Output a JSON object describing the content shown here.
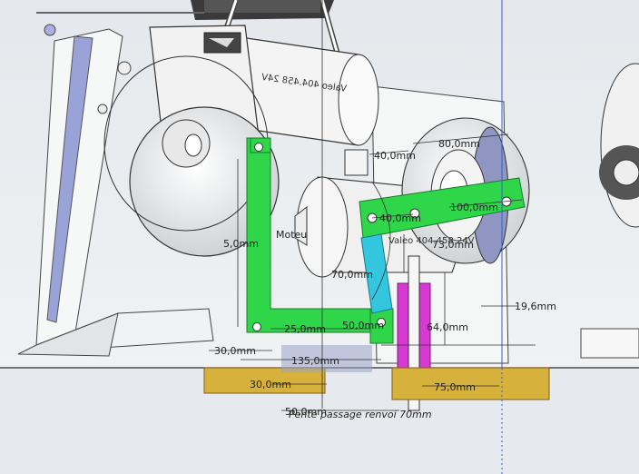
{
  "labels": {
    "motor_upper": "Valeo 404.458 24V",
    "motor_lower": "Valeo 404.458 24V",
    "motor_label": "Moteu",
    "note": "Pente passage renvoi 70mm"
  },
  "dimensions": {
    "d40": "40,0mm",
    "d80": "80,0mm",
    "d100": "100,0mm",
    "d40b": "40,0mm",
    "d73": "73,0mm",
    "d5": "5,0mm",
    "d70": "70,0mm",
    "d50": "50,0mm",
    "d25": "25,0mm",
    "d64": "64,0mm",
    "d19": "19,6mm",
    "d30": "30,0mm",
    "d135": "135,0mm",
    "d30b": "30,0mm",
    "d50b": "50,0mm",
    "d75": "75,0mm"
  },
  "colors": {
    "background": "#e9edf0",
    "bracket_green": "#2fd64a",
    "link_cyan": "#33c6de",
    "post_magenta": "#d63ad0",
    "block_gold": "#d6b23c",
    "panel_blue": "#9aa3d8",
    "axis_blue": "#3a5ad6"
  }
}
